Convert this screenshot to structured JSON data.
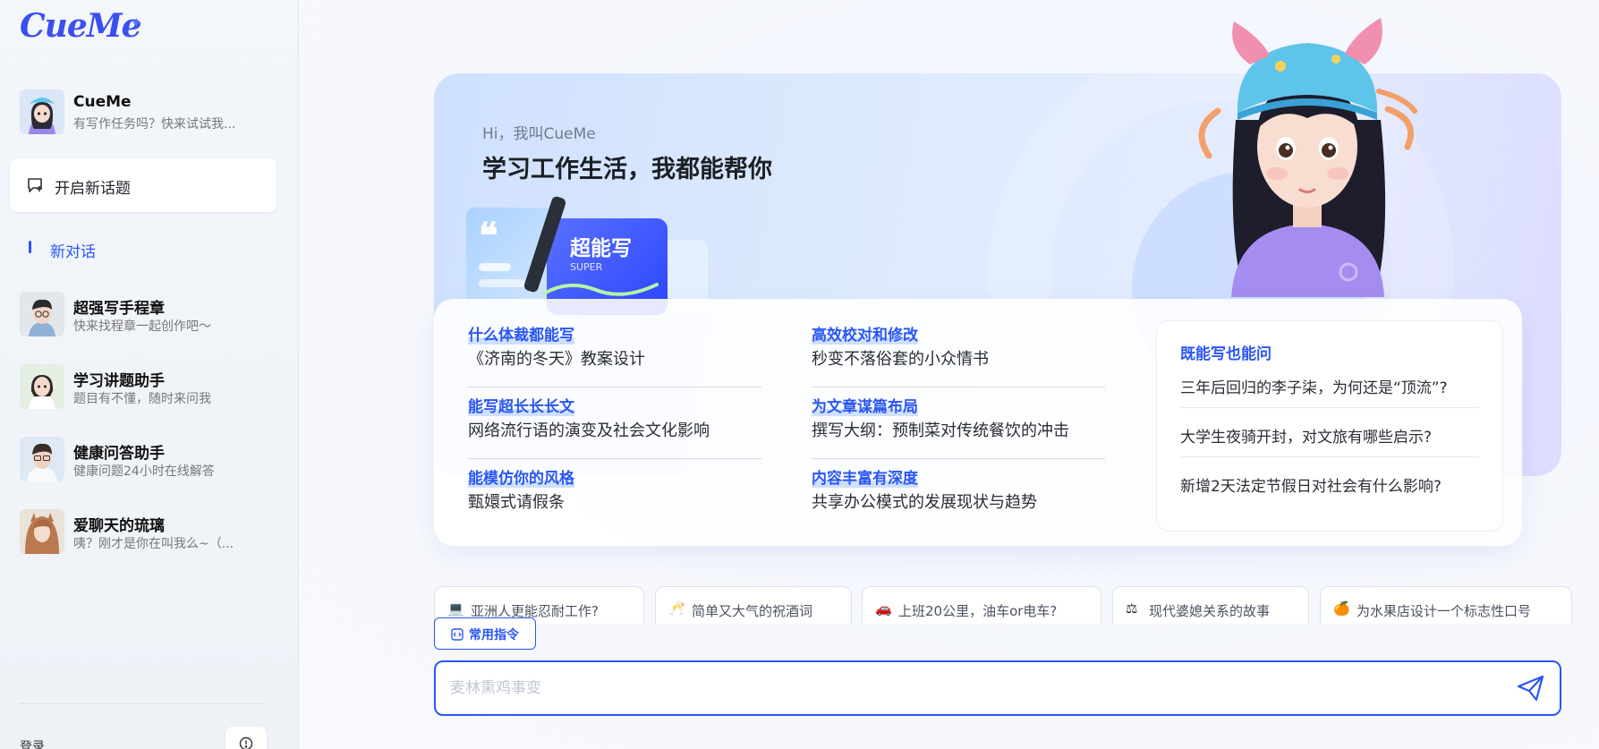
{
  "app": {
    "logo": "CueMe"
  },
  "sidebar": {
    "bots": [
      {
        "name": "CueMe",
        "desc": "有写作任务吗？快来试试我..."
      },
      {
        "name": "超强写手程章",
        "desc": "快来找程章一起创作吧～"
      },
      {
        "name": "学习讲题助手",
        "desc": "题目有不懂，随时来问我"
      },
      {
        "name": "健康问答助手",
        "desc": "健康问题24小时在线解答"
      },
      {
        "name": "爱聊天的琉璃",
        "desc": "咦？刚才是你在叫我么~（..."
      }
    ],
    "new_topic": "开启新话题",
    "active_conversation": "新对话",
    "login": "登录"
  },
  "hero": {
    "greeting": "Hi，我叫CueMe",
    "title": "学习工作生活，我都能帮你",
    "badge_title": "超能写",
    "badge_sub": "SUPER"
  },
  "prompts": [
    {
      "title": "什么体裁都能写",
      "sub": "《济南的冬天》教案设计"
    },
    {
      "title": "能写超长长长文",
      "sub": "网络流行语的演变及社会文化影响"
    },
    {
      "title": "能模仿你的风格",
      "sub": "甄嬛式请假条"
    },
    {
      "title": "高效校对和修改",
      "sub": "秒变不落俗套的小众情书"
    },
    {
      "title": "为文章谋篇布局",
      "sub": "撰写大纲：预制菜对传统餐饮的冲击"
    },
    {
      "title": "内容丰富有深度",
      "sub": "共享办公模式的发展现状与趋势"
    }
  ],
  "side_box": {
    "title": "既能写也能问",
    "questions": [
      "三年后回归的李子柒，为何还是“顶流”?",
      "大学生夜骑开封，对文旅有哪些启示?",
      "新增2天法定节假日对社会有什么影响?"
    ]
  },
  "chips": [
    {
      "icon": "💻",
      "text": "亚洲人更能忍耐工作?"
    },
    {
      "icon": "🥂",
      "text": "简单又大气的祝酒词"
    },
    {
      "icon": "🚗",
      "text": "上班20公里，油车or电车?"
    },
    {
      "icon": "⚖",
      "text": "现代婆媳关系的故事"
    },
    {
      "icon": "🍊",
      "text": "为水果店设计一个标志性口号"
    }
  ],
  "command_button": "常用指令",
  "input": {
    "placeholder": "麦林熏鸡事变",
    "value": ""
  },
  "colors": {
    "accent": "#2a56f5",
    "sidebar_bg": "#f1f4f8"
  }
}
